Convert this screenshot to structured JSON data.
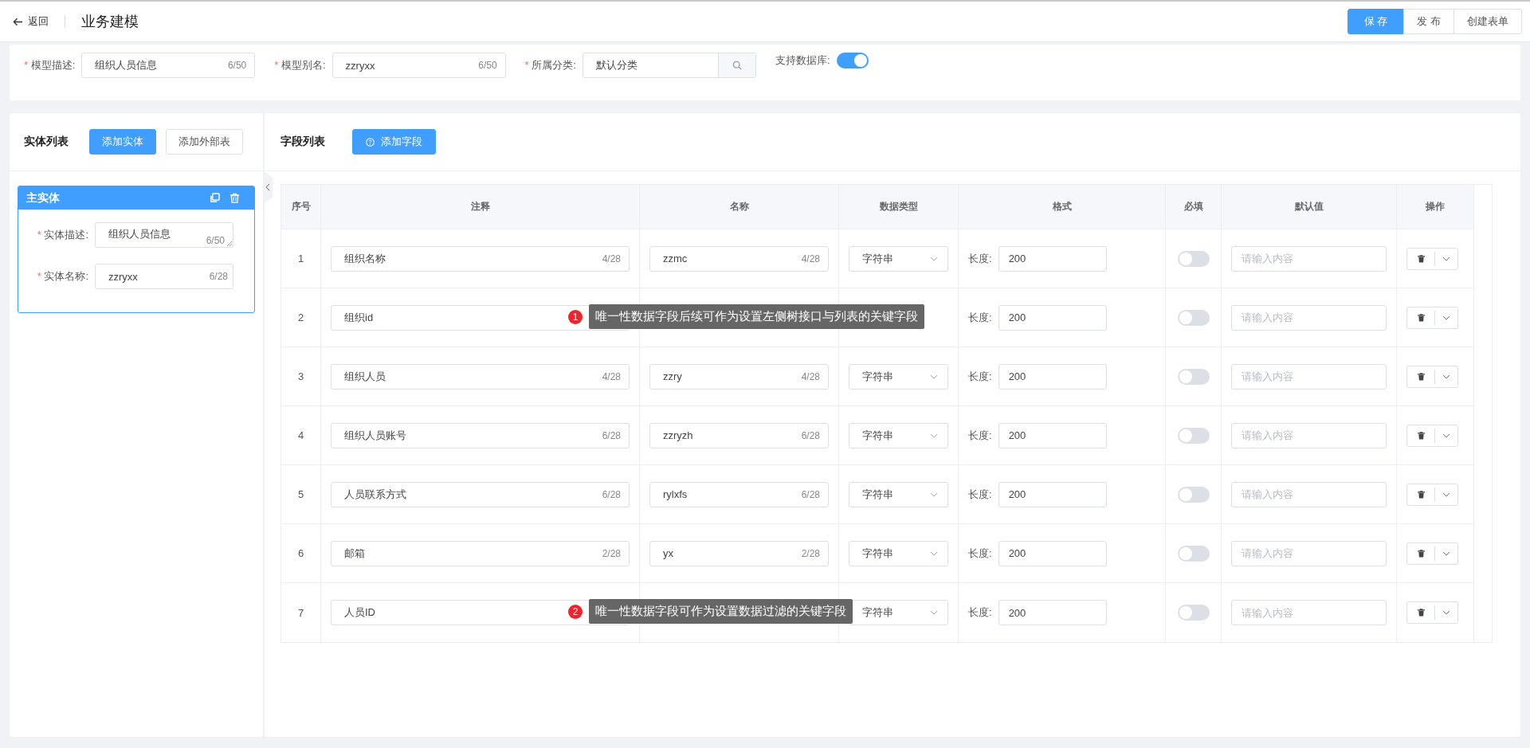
{
  "header": {
    "back": "返回",
    "title": "业务建模",
    "buttons": [
      {
        "label": "保 存",
        "kind": "primary"
      },
      {
        "label": "发 布",
        "kind": "default"
      },
      {
        "label": "创建表单",
        "kind": "default"
      }
    ]
  },
  "model_form": {
    "fields": [
      {
        "kind": "text",
        "mark": "*",
        "label": "模型描述:",
        "value": "组织人员信息",
        "count": "6/50"
      },
      {
        "kind": "text",
        "mark": "*",
        "label": "模型别名:",
        "value": "zzryxx",
        "count": "6/50"
      },
      {
        "kind": "search",
        "mark": "*",
        "label": "所属分类:",
        "value": "默认分类"
      },
      {
        "kind": "switch",
        "label": "支持数据库:",
        "on": true
      }
    ]
  },
  "entity_panel": {
    "title": "实体列表",
    "buttons": [
      {
        "label": "添加实体",
        "kind": "primary"
      },
      {
        "label": "添加外部表",
        "kind": "default"
      }
    ],
    "entity": {
      "title": "主实体",
      "fields": [
        {
          "kind": "textarea",
          "mark": "*",
          "label": "实体描述:",
          "value": "组织人员信息",
          "count": "6/50"
        },
        {
          "kind": "text",
          "mark": "*",
          "label": "实体名称:",
          "value": "zzryxx",
          "count": "6/28"
        }
      ]
    }
  },
  "field_panel": {
    "title": "字段列表",
    "add_button": "添加字段",
    "table": {
      "columns": [
        "序号",
        "注释",
        "名称",
        "数据类型",
        "格式",
        "必填",
        "默认值",
        "操作"
      ],
      "rows": [
        {
          "index": "1",
          "note": "组织名称",
          "note_count": "4/28",
          "name": "zzmc",
          "name_count": "4/28",
          "type": "字符串",
          "format_label": "长度:",
          "length": "200",
          "required": false,
          "default_placeholder": "请输入内容"
        },
        {
          "index": "2",
          "note": "组织id",
          "format_label": "长度:",
          "length": "200",
          "required": false,
          "default_placeholder": "请输入内容",
          "tip": {
            "badge": "1",
            "text": "唯一性数据字段后续可作为设置左侧树接口与列表的关键字段"
          }
        },
        {
          "index": "3",
          "note": "组织人员",
          "note_count": "4/28",
          "name": "zzry",
          "name_count": "4/28",
          "type": "字符串",
          "format_label": "长度:",
          "length": "200",
          "required": false,
          "default_placeholder": "请输入内容"
        },
        {
          "index": "4",
          "note": "组织人员账号",
          "note_count": "6/28",
          "name": "zzryzh",
          "name_count": "6/28",
          "type": "字符串",
          "format_label": "长度:",
          "length": "200",
          "required": false,
          "default_placeholder": "请输入内容"
        },
        {
          "index": "5",
          "note": "人员联系方式",
          "note_count": "6/28",
          "name": "rylxfs",
          "name_count": "6/28",
          "type": "字符串",
          "format_label": "长度:",
          "length": "200",
          "required": false,
          "default_placeholder": "请输入内容"
        },
        {
          "index": "6",
          "note": "邮箱",
          "note_count": "2/28",
          "name": "yx",
          "name_count": "2/28",
          "type": "字符串",
          "format_label": "长度:",
          "length": "200",
          "required": false,
          "default_placeholder": "请输入内容"
        },
        {
          "index": "7",
          "note": "人员ID",
          "type": "字符串",
          "format_label": "长度:",
          "length": "200",
          "required": false,
          "default_placeholder": "请输入内容",
          "tip": {
            "badge": "2",
            "text": "唯一性数据字段可作为设置数据过滤的关键字段"
          }
        }
      ]
    }
  }
}
